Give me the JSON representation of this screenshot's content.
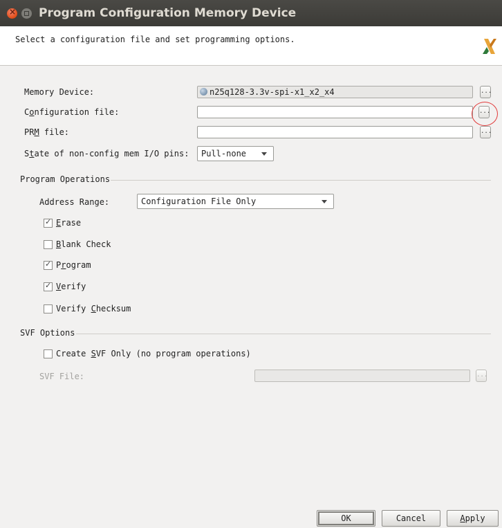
{
  "window": {
    "title": "Program Configuration Memory Device"
  },
  "header": {
    "subtitle": "Select a configuration file and set programming options.",
    "logo_icon": "xilinx-logo-icon"
  },
  "fields": {
    "memory_device": {
      "label": "Memory Device:",
      "value": "n25q128-3.3v-spi-x1_x2_x4",
      "browse": "..."
    },
    "configuration_file": {
      "label_pre": "C",
      "label_u": "o",
      "label_post": "nfiguration file:",
      "value": "",
      "browse": "..."
    },
    "prm_file": {
      "label_pre": "PR",
      "label_u": "M",
      "label_post": " file:",
      "value": "",
      "browse": "..."
    },
    "state_pins": {
      "label_pre": "S",
      "label_u": "t",
      "label_post": "ate of non-config mem I/O pins:",
      "value": "Pull-none"
    }
  },
  "program_operations": {
    "title": "Program Operations",
    "address_range": {
      "label": "Address Range:",
      "value": "Configuration File Only"
    },
    "options": [
      {
        "pre": "",
        "u": "E",
        "post": "rase",
        "checked": true
      },
      {
        "pre": "",
        "u": "B",
        "post": "lank Check",
        "checked": false
      },
      {
        "pre": "P",
        "u": "r",
        "post": "ogram",
        "checked": true
      },
      {
        "pre": "",
        "u": "V",
        "post": "erify",
        "checked": true
      },
      {
        "pre": "Verify ",
        "u": "C",
        "post": "hecksum",
        "checked": false
      }
    ]
  },
  "svf_options": {
    "title": "SVF Options",
    "create_svf": {
      "pre": "Create ",
      "u": "S",
      "post": "VF Only (no program operations)",
      "checked": false
    },
    "svf_file": {
      "label": "SVF File:",
      "value": "",
      "browse": "..."
    }
  },
  "buttons": {
    "ok": "OK",
    "cancel": "Cancel",
    "apply_u": "A",
    "apply_post": "pply"
  },
  "colors": {
    "titlebar": "#3c3b37",
    "close": "#df4b16",
    "annotation": "#e23c3c"
  }
}
